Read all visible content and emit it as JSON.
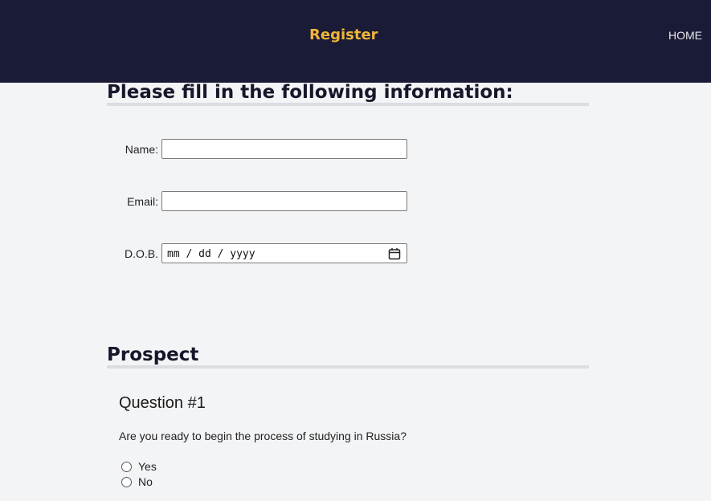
{
  "header": {
    "title": "Register",
    "nav_home": "HOME"
  },
  "info_section": {
    "title": "Please fill in the following information:",
    "fields": {
      "name": {
        "label": "Name:",
        "value": ""
      },
      "email": {
        "label": "Email:",
        "value": ""
      },
      "dob": {
        "label": "D.O.B.",
        "placeholder": "mm / dd / yyyy"
      }
    }
  },
  "prospect_section": {
    "title": "Prospect",
    "question": {
      "title": "Question #1",
      "text": "Are you ready to begin the process of studying in Russia?",
      "options": [
        "Yes",
        "No"
      ]
    }
  },
  "colors": {
    "header_bg": "#1a1b36",
    "accent": "#f0b43a",
    "page_bg": "#f3f4f6"
  }
}
